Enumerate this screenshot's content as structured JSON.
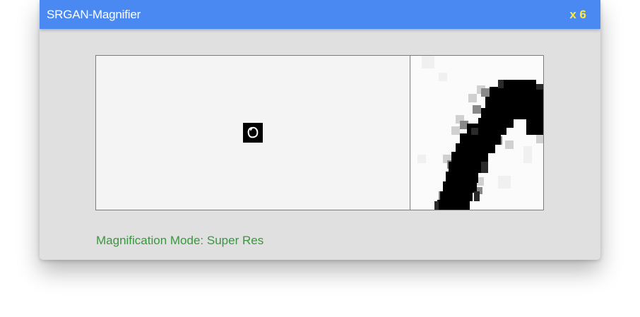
{
  "window": {
    "title": "SRGAN-Magnifier",
    "zoom_label": "x 6",
    "title_color": "#4a89f2",
    "zoom_color": "#ffeb3b"
  },
  "viewer": {
    "source_thumbnail_icon": "handwritten-digit-zero-icon",
    "magnified_view_icon": "magnified-digit-stroke"
  },
  "status": {
    "mode_prefix": "Magnification Mode:",
    "mode_value": "Super Res",
    "color": "#3a963f"
  }
}
